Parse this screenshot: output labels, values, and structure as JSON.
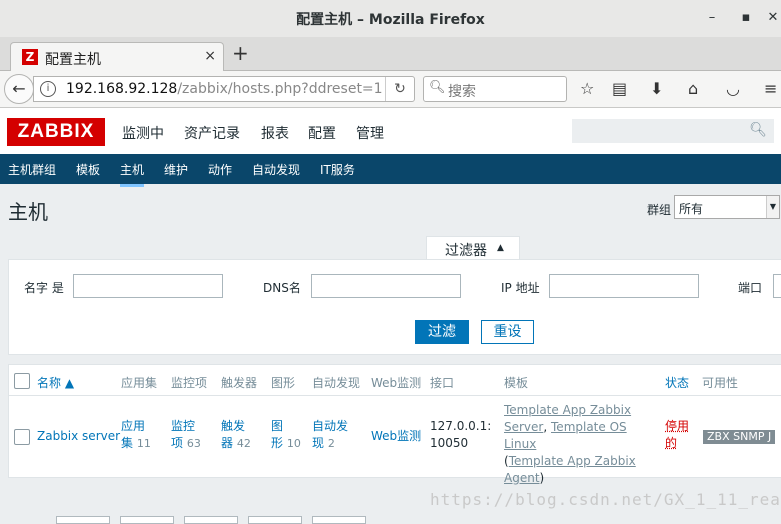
{
  "window": {
    "title": "配置主机 – Mozilla Firefox",
    "min": "–",
    "max": "▪",
    "close": "✕"
  },
  "browser": {
    "tab_title": "配置主机",
    "tab_favicon": "Z",
    "tab_close": "×",
    "new_tab": "+",
    "url_host": "192.168.92.128",
    "url_path": "/zabbix/hosts.php?ddreset=1",
    "search_placeholder": "搜索"
  },
  "zabbix": {
    "logo": "ZABBIX",
    "menu": [
      "监测中",
      "资产记录",
      "报表",
      "配置",
      "管理"
    ],
    "submenu": [
      "主机群组",
      "模板",
      "主机",
      "维护",
      "动作",
      "自动发现",
      "IT服务"
    ],
    "page_title": "主机",
    "group_label": "群组",
    "group_value": "所有",
    "filter": {
      "tab_label": "过滤器",
      "name_label": "名字 是",
      "dns_label": "DNS名",
      "ip_label": "IP 地址",
      "port_label": "端口",
      "apply": "过滤",
      "reset": "重设"
    },
    "table": {
      "headers": [
        "名称 ▲",
        "应用集",
        "监控项",
        "触发器",
        "图形",
        "自动发现",
        "Web监测",
        "接口",
        "模板",
        "状态",
        "可用性"
      ],
      "row": {
        "name": "Zabbix server",
        "apps_a": "应用",
        "apps_b": "集",
        "apps_count": "11",
        "items_a": "监控",
        "items_b": "项",
        "items_count": "63",
        "triggers_a": "触发",
        "triggers_b": "器",
        "triggers_count": "42",
        "graphs_a": "图",
        "graphs_b": "形",
        "graphs_count": "10",
        "discovery_a": "自动发",
        "discovery_b": "现",
        "discovery_count": "2",
        "web": "Web监测",
        "iface_a": "127.0.0.1:",
        "iface_b": "10050",
        "tmpl_1": "Template App Zabbix",
        "tmpl_2": "Server",
        "tmpl_comma": ",",
        "tmpl_3": "Template OS Linux",
        "tmpl_open": "(",
        "tmpl_4": "Template App Zabbix",
        "tmpl_5": "Agent",
        "tmpl_close": ")",
        "status_a": "停用",
        "status_b": "的",
        "availability": "ZBX  SNMP  J"
      }
    }
  },
  "watermark": "https://blog.csdn.net/GX_1_11_real"
}
